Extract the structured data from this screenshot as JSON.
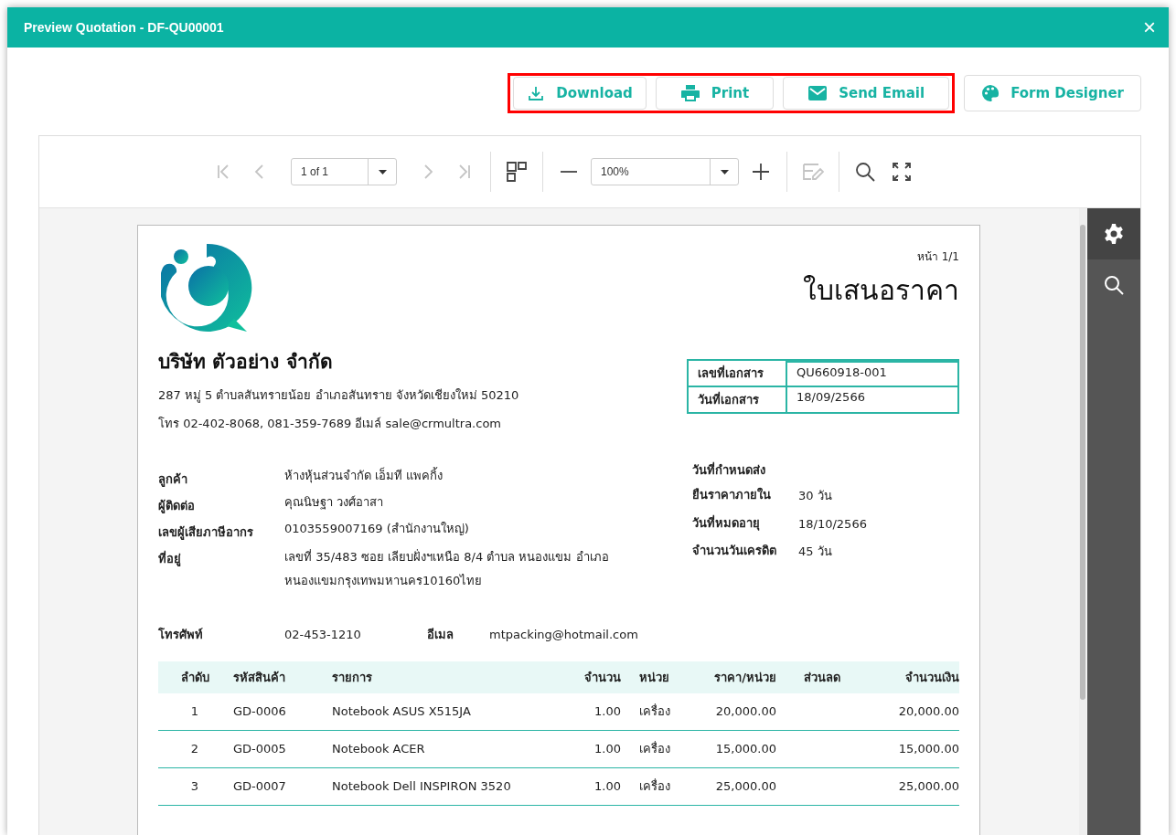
{
  "window": {
    "title": "Preview Quotation - DF-QU00001",
    "close": "×"
  },
  "actions": [
    {
      "highlighted": true,
      "buttons": [
        {
          "kind": "download",
          "label": "Download"
        },
        {
          "kind": "print",
          "label": "Print"
        },
        {
          "kind": "email",
          "label": "Send Email"
        }
      ]
    },
    {
      "highlighted": false,
      "buttons": [
        {
          "kind": "palette",
          "label": "Form Designer"
        }
      ]
    }
  ],
  "viewer_toolbar": [
    [
      {
        "kind": "first",
        "disabled": true
      },
      {
        "kind": "prev",
        "disabled": true
      },
      {
        "kind": "page_select",
        "value": "1 of 1"
      },
      {
        "kind": "next",
        "disabled": true
      },
      {
        "kind": "last",
        "disabled": true
      }
    ],
    [
      {
        "kind": "multipage",
        "disabled": false
      }
    ],
    [
      {
        "kind": "zoom_out",
        "disabled": false
      },
      {
        "kind": "zoom_select",
        "value": "100%"
      },
      {
        "kind": "zoom_in",
        "disabled": false
      }
    ],
    [
      {
        "kind": "edit",
        "disabled": true
      }
    ],
    [
      {
        "kind": "search",
        "disabled": false
      },
      {
        "kind": "fullscreen",
        "disabled": false
      }
    ]
  ],
  "side_panel": [
    {
      "kind": "settings",
      "selected": true
    },
    {
      "kind": "search",
      "selected": false
    }
  ],
  "document": {
    "page_number": "หน้า 1/1",
    "title": "ใบเสนอราคา",
    "company": {
      "name": "บริษัท ตัวอย่าง จำกัด",
      "address": "287 หมู่ 5 ตำบลสันทรายน้อย อำเภอสันทราย จังหวัดเชียงใหม่ 50210",
      "contact": "โทร 02-402-8068, 081-359-7689 อีเมล์ sale@crmultra.com"
    },
    "doc_info": [
      {
        "label": "เลขที่เอกสาร",
        "value": "QU660918-001"
      },
      {
        "label": "วันที่เอกสาร",
        "value": "18/09/2566"
      }
    ],
    "customer": [
      {
        "label": "ลูกค้า",
        "value": "ห้างหุ้นส่วนจำกัด เอ็มที แพคกิ้ง"
      },
      {
        "label": "ผู้ติดต่อ",
        "value": "คุณนิษฐา วงศ์อาสา"
      },
      {
        "label": "เลขผู้เสียภาษีอากร",
        "value": "0103559007169 (สำนักงานใหญ่)"
      },
      {
        "label": "ที่อยู่",
        "value": "เลขที่ 35/483 ซอย เลียบฝั่งฯเหนือ 8/4 ตำบล หนองแขม อำเภอ หนองแขมกรุงเทพมหานคร10160ไทย"
      }
    ],
    "terms": [
      {
        "label": "วันที่กำหนดส่ง"
      },
      {
        "label": "ยืนราคาภายใน",
        "value": "30 วัน"
      },
      {
        "label": "วันที่หมดอายุ",
        "value": "18/10/2566"
      },
      {
        "label": "จำนวนวันเครดิต",
        "value": "45 วัน"
      }
    ],
    "phone": {
      "label": "โทรศัพท์",
      "value": "02-453-1210"
    },
    "email": {
      "label": "อีเมล",
      "value": "mtpacking@hotmail.com"
    },
    "table": {
      "columns": [
        "ลำดับ",
        "รหัสสินค้า",
        "รายการ",
        "จำนวน",
        "หน่วย",
        "ราคา/หน่วย",
        "ส่วนลด",
        "จำนวนเงิน"
      ],
      "rows": [
        [
          "1",
          "GD-0006",
          "Notebook ASUS X515JA",
          "1.00",
          "เครื่อง",
          "20,000.00",
          "",
          "20,000.00"
        ],
        [
          "2",
          "GD-0005",
          "Notebook ACER",
          "1.00",
          "เครื่อง",
          "15,000.00",
          "",
          "15,000.00"
        ],
        [
          "3",
          "GD-0007",
          "Notebook Dell INSPIRON 3520",
          "1.00",
          "เครื่อง",
          "25,000.00",
          "",
          "25,000.00"
        ]
      ]
    }
  }
}
